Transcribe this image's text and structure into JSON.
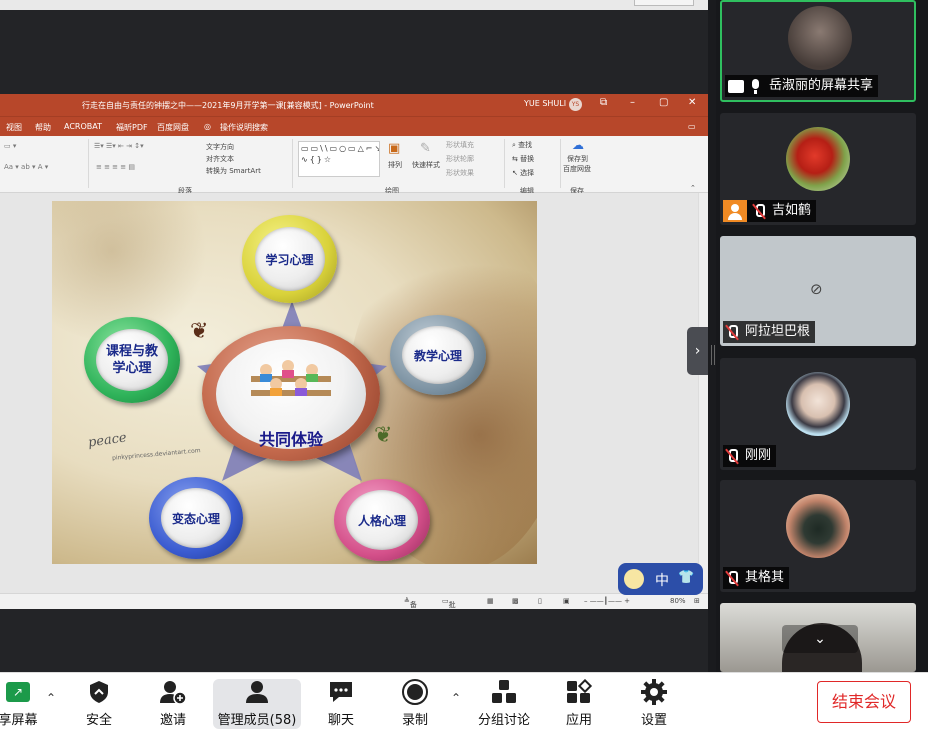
{
  "ppt": {
    "window_title": "行走在自由与责任的钟摆之中——2021年9月开学第一课[兼容模式] - PowerPoint",
    "user": "YUE SHULI",
    "user_initials": "YS",
    "menu": [
      "视图",
      "帮助",
      "ACROBAT",
      "福昕PDF",
      "百度网盘",
      "操作说明搜索"
    ],
    "ribbon_items": {
      "text_direction": "文字方向",
      "align_text": "对齐文本",
      "to_smartart": "转换为 SmartArt",
      "arrange": "排列",
      "quick_styles": "快速样式",
      "shape_fill": "形状填充",
      "shape_outline": "形状轮廓",
      "shape_effects": "形状效果",
      "find": "查找",
      "replace": "替换",
      "select": "选择",
      "save_to": "保存到",
      "baidu": "百度网盘",
      "grp_paragraph": "段落",
      "grp_drawing": "绘图",
      "grp_editing": "编辑",
      "grp_save": "保存"
    },
    "status": {
      "notes": "备注",
      "comments": "批注",
      "zoom": "80%"
    }
  },
  "slide": {
    "center_label": "共同体验",
    "bubbles": {
      "top": "学习心理",
      "left": "课程与教学心理",
      "right": "教学心理",
      "bottom_left": "变态心理",
      "bottom_right": "人格心理"
    },
    "signature": "peace",
    "signature_sub": "pinkyprincess.deviantart.com"
  },
  "floating_badge": {
    "ime": "中",
    "shirt": "👕"
  },
  "participants": [
    {
      "name": "岳淑丽的屏幕共享",
      "status": "sharing"
    },
    {
      "name": "吉如鹤",
      "status": "muted"
    },
    {
      "name": "阿拉坦巴根",
      "status": "muted"
    },
    {
      "name": "刚刚",
      "status": "muted"
    },
    {
      "name": "其格其",
      "status": "muted"
    }
  ],
  "toolbar": {
    "share": "享屏幕",
    "security": "安全",
    "invite": "邀请",
    "participants": "管理成员(58)",
    "chat": "聊天",
    "record": "录制",
    "breakout": "分组讨论",
    "apps": "应用",
    "settings": "设置",
    "end": "结束会议"
  },
  "colors": {
    "ppt_red": "#b7472a",
    "active_green": "#2fbf5f",
    "end_red": "#e02828"
  }
}
